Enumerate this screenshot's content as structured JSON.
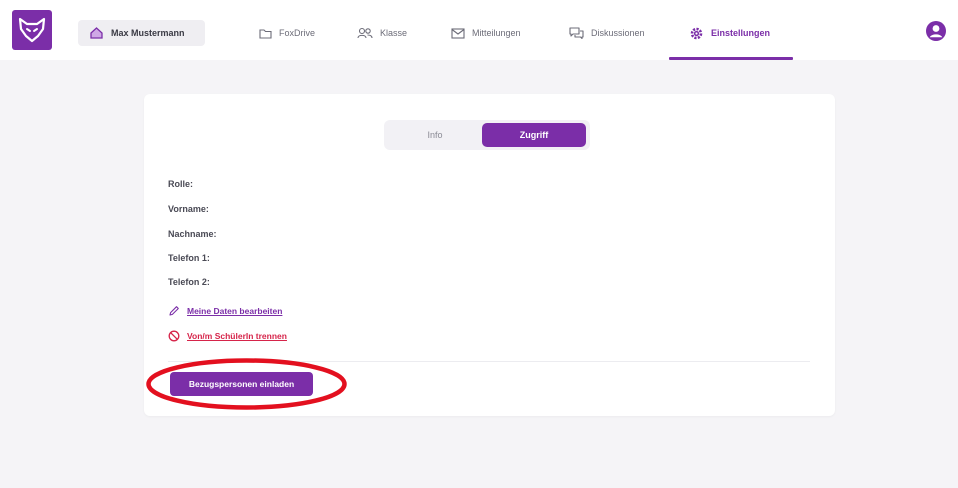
{
  "header": {
    "logo_icon": "fox-icon",
    "user_chip": {
      "icon": "home-icon",
      "name": "Max Mustermann"
    },
    "nav": [
      {
        "label": "FoxDrive",
        "icon": "folder-icon"
      },
      {
        "label": "Klasse",
        "icon": "users-icon"
      },
      {
        "label": "Mitteilungen",
        "icon": "mail-icon"
      },
      {
        "label": "Diskussionen",
        "icon": "chat-icon"
      },
      {
        "label": "Einstellungen",
        "icon": "gear-icon",
        "active": true
      }
    ],
    "profile_icon": "user-circle-icon"
  },
  "toggle": {
    "options": [
      "Info",
      "Zugriff"
    ],
    "selected": "Zugriff"
  },
  "fields": [
    {
      "label": "Rolle:"
    },
    {
      "label": "Vorname:"
    },
    {
      "label": "Nachname:"
    },
    {
      "label": "Telefon 1:"
    },
    {
      "label": "Telefon 2:"
    }
  ],
  "actions": {
    "edit": {
      "label": "Meine Daten bearbeiten",
      "icon": "pencil-icon"
    },
    "unlink": {
      "label": "Von/m SchülerIn trennen",
      "icon": "prohibited-icon"
    }
  },
  "invite_button": {
    "label": "Bezugspersonen einladen"
  },
  "colors": {
    "accent": "#7b2ea8",
    "danger": "#d6244a",
    "annotation": "#e3101f"
  }
}
